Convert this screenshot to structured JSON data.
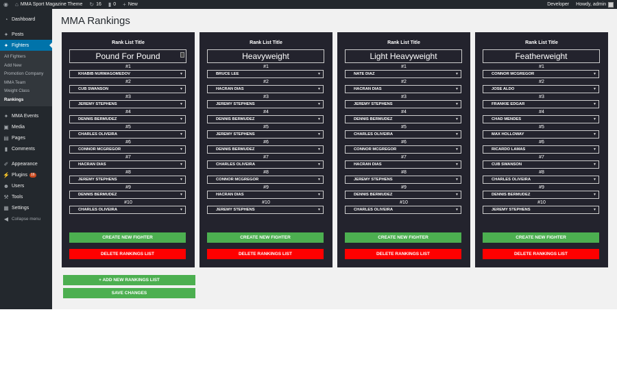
{
  "adminbar": {
    "wp_logo": "wordpress-icon",
    "site_name": "MMA Sport Magazine Theme",
    "updates_count": "16",
    "comments_count": "0",
    "new_label": "New",
    "developer_label": "Developer",
    "howdy_label": "Howdy, admin"
  },
  "sidebar": {
    "dashboard": "Dashboard",
    "posts": "Posts",
    "fighters": "Fighters",
    "fighters_sub": [
      "All Fighters",
      "Add New",
      "Promotion Company",
      "MMA Team",
      "Weight Class",
      "Rankings"
    ],
    "mma_events": "MMA Events",
    "media": "Media",
    "pages": "Pages",
    "comments": "Comments",
    "appearance": "Appearance",
    "plugins": "Plugins",
    "plugins_badge": "16",
    "users": "Users",
    "tools": "Tools",
    "settings": "Settings",
    "collapse": "Collapse menu"
  },
  "page": {
    "title": "MMA Rankings",
    "rank_list_label": "Rank List Title",
    "create_label": "CREATE NEW FIGHTER",
    "delete_label": "DELETE RANKINGS LIST",
    "add_list_label": "+ ADD NEW RANKINGS LIST",
    "save_label": "SAVE CHANGES"
  },
  "lists": [
    {
      "title": "Pound For Pound",
      "fighters": [
        "KHABIB NURMAGOMEDOV",
        "CUB SWANSON",
        "JEREMY STEPHENS",
        "DENNIS BERMUDEZ",
        "CHARLES OLIVEIRA",
        "CONNOR MCGREGOR",
        "HACRAN DIAS",
        "JEREMY STEPHENS",
        "DENNIS BERMUDEZ",
        "CHARLES OLIVEIRA"
      ]
    },
    {
      "title": "Heavyweight",
      "fighters": [
        "BRUCE LEE",
        "HACRAN DIAS",
        "JEREMY STEPHENS",
        "DENNIS BERMUDEZ",
        "JEREMY STEPHENS",
        "DENNIS BERMUDEZ",
        "CHARLES OLIVEIRA",
        "CONNOR MCGREGOR",
        "HACRAN DIAS",
        "JEREMY STEPHENS"
      ]
    },
    {
      "title": "Light Heavyweight",
      "fighters": [
        "NATE DIAZ",
        "HACRAN DIAS",
        "JEREMY STEPHENS",
        "DENNIS BERMUDEZ",
        "CHARLES OLIVEIRA",
        "CONNOR MCGREGOR",
        "HACRAN DIAS",
        "JEREMY STEPHENS",
        "DENNIS BERMUDEZ",
        "CHARLES OLIVEIRA"
      ]
    },
    {
      "title": "Featherweight",
      "fighters": [
        "CONNOR MCGREGOR",
        "JOSE ALDO",
        "FRANKIE EDGAR",
        "CHAD MENDES",
        "MAX HOLLOWAY",
        "RICARDO LAMAS",
        "CUB SWANSON",
        "CHARLES OLIVEIRA",
        "DENNIS BERMUDEZ",
        "JEREMY STEPHENS"
      ]
    }
  ],
  "ranks": [
    "#1",
    "#2",
    "#3",
    "#4",
    "#5",
    "#6",
    "#7",
    "#8",
    "#9",
    "#10"
  ],
  "colors": {
    "panel_bg": "#23232d",
    "green": "#4caf50",
    "red": "#ff0000",
    "admin_blue": "#0073aa"
  }
}
